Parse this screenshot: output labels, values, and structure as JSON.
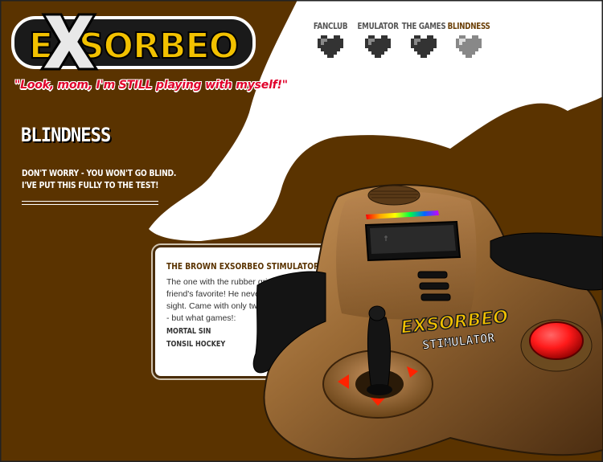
{
  "brand": {
    "logo_text": "EXSORBEO",
    "tagline": "\"Look, mom, I'm STILL playing with myself!\""
  },
  "nav": {
    "items": [
      {
        "label": "FANCLUB",
        "active": false
      },
      {
        "label": "EMULATOR",
        "active": false
      },
      {
        "label": "THE GAMES",
        "active": false
      },
      {
        "label": "BLINDNESS",
        "active": true
      }
    ]
  },
  "page": {
    "title": "BLINDNESS",
    "intro_line1": "DON'T WORRY - YOU WON'T GO BLIND.",
    "intro_line2": "I'VE PUT THIS FULLY TO THE TEST!"
  },
  "info": {
    "title": "THE BROWN EXSORBEO STIMULATOR",
    "description": "The one with the rubber grip. My best friend's favorite! He never let it leave his sight. Came with only two classic games - but what games!:",
    "games": [
      "MORTAL SIN",
      "TONSIL HOCKEY"
    ]
  },
  "controller": {
    "logo_text": "EXSORBEO",
    "model_text": "STIMULATOR"
  },
  "colors": {
    "background_brown": "#5a3300",
    "tagline_red": "#e0002a",
    "logo_gold": "#f2c100",
    "active_nav": "#6b3f06",
    "button_red": "#ff1a1a"
  }
}
